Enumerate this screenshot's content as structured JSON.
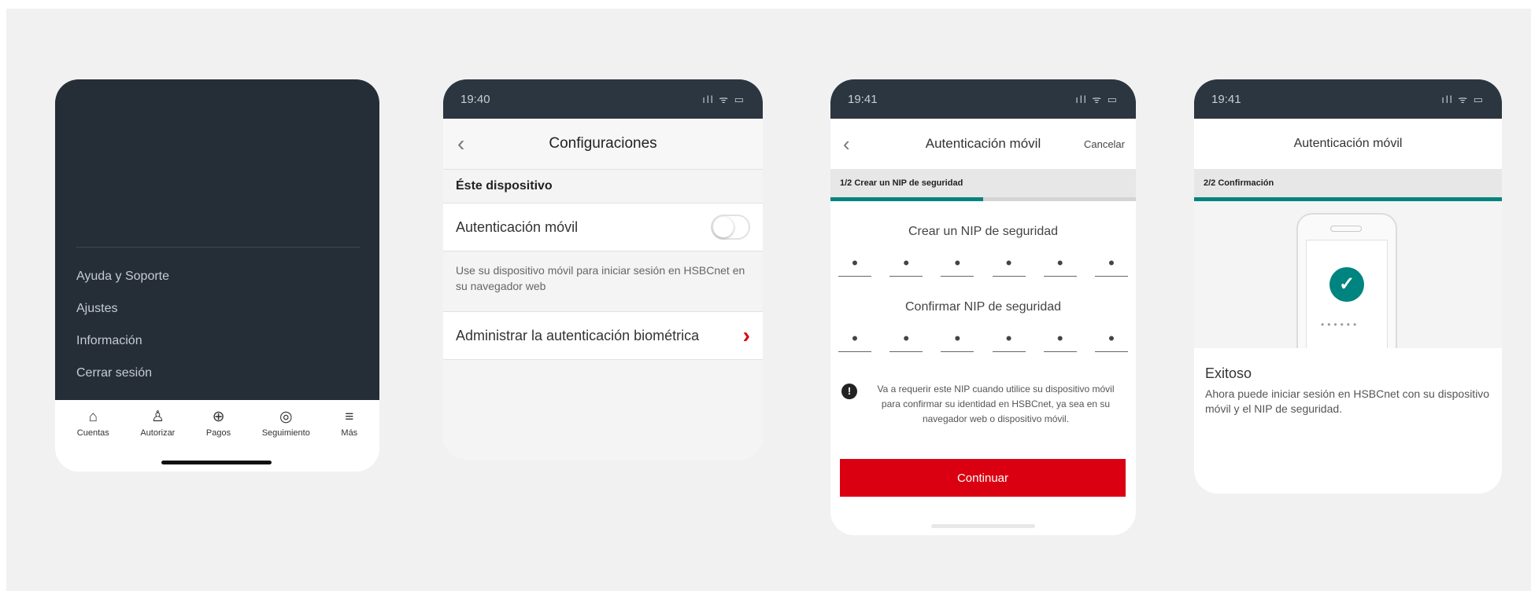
{
  "phone1": {
    "menu": [
      "Ayuda y Soporte",
      "Ajustes",
      "Información",
      "Cerrar sesión"
    ],
    "tabs": [
      {
        "icon": "⌂",
        "label": "Cuentas"
      },
      {
        "icon": "♙",
        "label": "Autorizar"
      },
      {
        "icon": "⊕",
        "label": "Pagos"
      },
      {
        "icon": "◎",
        "label": "Seguimiento"
      },
      {
        "icon": "≡",
        "label": "Más"
      }
    ]
  },
  "phone2": {
    "status_time": "19:40",
    "status_icons": "ıll ᯤ ▭",
    "title": "Configuraciones",
    "section": "Éste dispositivo",
    "auth_label": "Autenticación móvil",
    "auth_toggle_on": false,
    "description": "Use su dispositivo móvil para iniciar sesión en HSBCnet en su navegador web",
    "biometric_label": "Administrar la autenticación biométrica"
  },
  "phone3": {
    "status_time": "19:41",
    "status_icons": "ıll ᯤ ▭",
    "title": "Autenticación móvil",
    "cancel": "Cancelar",
    "step": "1/2 Crear un NIP de seguridad",
    "progress": 0.5,
    "create_label": "Crear un NIP de seguridad",
    "confirm_label": "Confirmar NIP de seguridad",
    "pin_dot": "•",
    "note": "Va a requerir este NIP cuando utilice su dispositivo móvil para confirmar su identidad en HSBCnet, ya sea en su navegador web o dispositivo móvil.",
    "button": "Continuar"
  },
  "phone4": {
    "status_time": "19:41",
    "status_icons": "ıll ᯤ ▭",
    "title": "Autenticación móvil",
    "step": "2/2 Confirmación",
    "progress": 1.0,
    "pin_mask": "••••••",
    "heading": "Exitoso",
    "message": "Ahora puede iniciar sesión en HSBCnet con su dispositivo móvil y el NIP de seguridad."
  },
  "colors": {
    "accent": "#db0011",
    "progress": "#00847f",
    "dark": "#252e37"
  }
}
